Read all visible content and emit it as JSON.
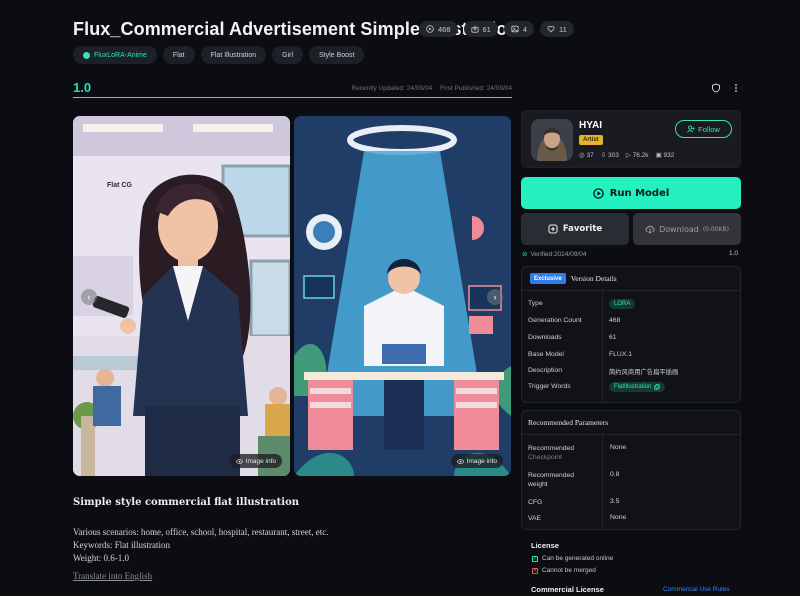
{
  "header": {
    "title": "Flux_Commercial Advertisement Simple Illustration",
    "stats": [
      {
        "icon": "play-icon",
        "value": "468"
      },
      {
        "icon": "download-icon",
        "value": "61"
      },
      {
        "icon": "image-icon",
        "value": "4"
      },
      {
        "icon": "heart-icon",
        "value": "11"
      }
    ],
    "tags": [
      "FluxLoRA-Anime",
      "Flat",
      "Flat Illustration",
      "Girl",
      "Style Boost"
    ]
  },
  "version": {
    "label": "1.0",
    "recently_updated": "Recently Updated: 24/09/04",
    "first_published": "First Published: 24/09/04"
  },
  "gallery": {
    "image_info_label": "Image info",
    "left_image_caption": "Flat CG"
  },
  "description": {
    "title": "Simple style commercial flat illustration",
    "lines": [
      "Various scenarios: home, office, school, hospital, restaurant, street, etc.",
      "Keywords: Flat illustration",
      "Weight: 0.6-1.0"
    ],
    "translate_link": "Translate into English"
  },
  "creator": {
    "name": "HYAI",
    "badge": "Artist",
    "follow_label": "Follow",
    "stats": [
      "37",
      "303",
      "76.2k",
      "932"
    ]
  },
  "actions": {
    "run_label": "Run Model",
    "favorite_label": "Favorite",
    "download_label": "Download",
    "download_size": "(0.00KB)"
  },
  "verified": {
    "text": "Verified:2024/09/04",
    "version": "1.0"
  },
  "details": {
    "exclusive_badge": "Exclusive",
    "title": "Version Details",
    "rows": [
      {
        "key": "Type",
        "value": "LORA"
      },
      {
        "key": "Generation Count",
        "value": "468"
      },
      {
        "key": "Downloads",
        "value": "61"
      },
      {
        "key": "Base Model",
        "value": "FLUX.1"
      },
      {
        "key": "Description",
        "value": "简约风商用广告扁平插画"
      },
      {
        "key": "Trigger Words",
        "value": "FlatIllustration"
      }
    ]
  },
  "params": {
    "title": "Recommended Parameters",
    "checkpoint_key": "Recommended",
    "checkpoint_sub": "Checkpoint",
    "checkpoint_value": "None",
    "weight_key_1": "Recommended",
    "weight_key_2": "weight",
    "weight_value": "0.8",
    "cfg_key": "CFG",
    "cfg_value": "3.5",
    "vae_key": "VAE",
    "vae_value": "None"
  },
  "license": {
    "title": "License",
    "items": [
      "Can be generated online",
      "Cannot be merged"
    ],
    "commercial_title": "Commercial License",
    "commercial_link": "Commercial Use Rules"
  },
  "colors": {
    "accent": "#25f0c0",
    "background": "#0c0d12",
    "exclusive": "#2f7bf0",
    "artist": "#e6b32c"
  }
}
